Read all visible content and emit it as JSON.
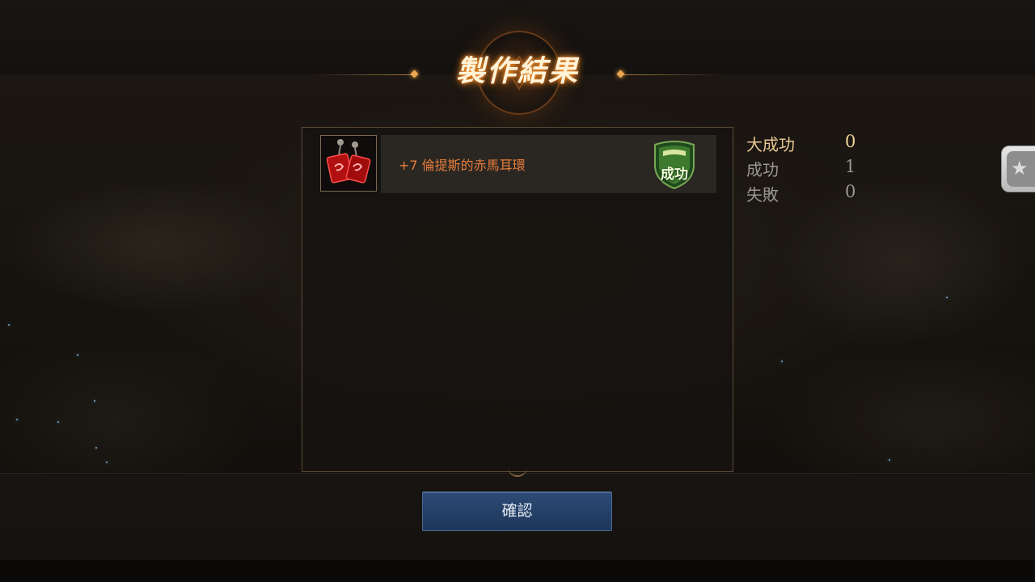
{
  "dialog": {
    "title": "製作結果",
    "confirm_label": "確認"
  },
  "results": [
    {
      "item_name": "+7 倫提斯的赤馬耳環",
      "item_icon": "red-horse-earring-icon",
      "status_label": "成功",
      "status_color": "#3d7a2e"
    }
  ],
  "stats": [
    {
      "label": "大成功",
      "value": "0"
    },
    {
      "label": "成功",
      "value": "1"
    },
    {
      "label": "失敗",
      "value": "0"
    }
  ],
  "side_tab": {
    "icon": "star-icon"
  },
  "colors": {
    "title_glow": "#ff9a30",
    "item_name": "#e67d3c",
    "highlight_stat": "#e8c892",
    "button": "#2d4b76"
  }
}
